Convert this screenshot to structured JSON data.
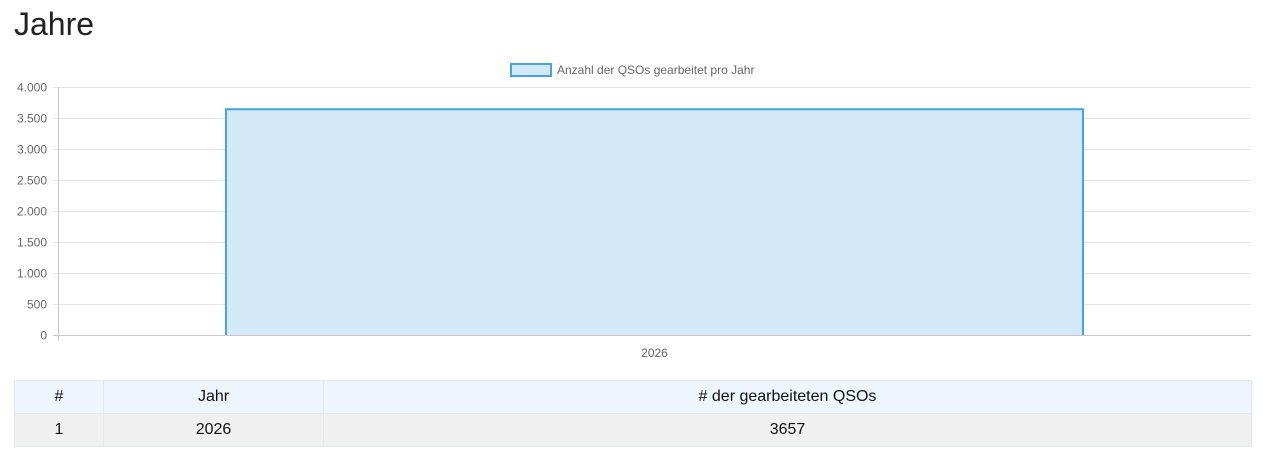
{
  "page": {
    "title": "Jahre"
  },
  "chart_data": {
    "type": "bar",
    "categories": [
      "2026"
    ],
    "series": [
      {
        "name": "Anzahl der QSOs gearbeitet pro Jahr",
        "values": [
          3657
        ]
      }
    ],
    "ylim": [
      0,
      4000
    ],
    "yticks": [
      "0",
      "500",
      "1.000",
      "1.500",
      "2.000",
      "2.500",
      "3.000",
      "3.500",
      "4.000"
    ],
    "ytick_values": [
      0,
      500,
      1000,
      1500,
      2000,
      2500,
      3000,
      3500,
      4000
    ],
    "legend": "top-center",
    "grid": true,
    "colors": {
      "fill": "#d4e9f8",
      "stroke": "#45a3e3"
    }
  },
  "table": {
    "headers": [
      "#",
      "Jahr",
      "# der gearbeiteten QSOs"
    ],
    "rows": [
      [
        "1",
        "2026",
        "3657"
      ]
    ]
  }
}
